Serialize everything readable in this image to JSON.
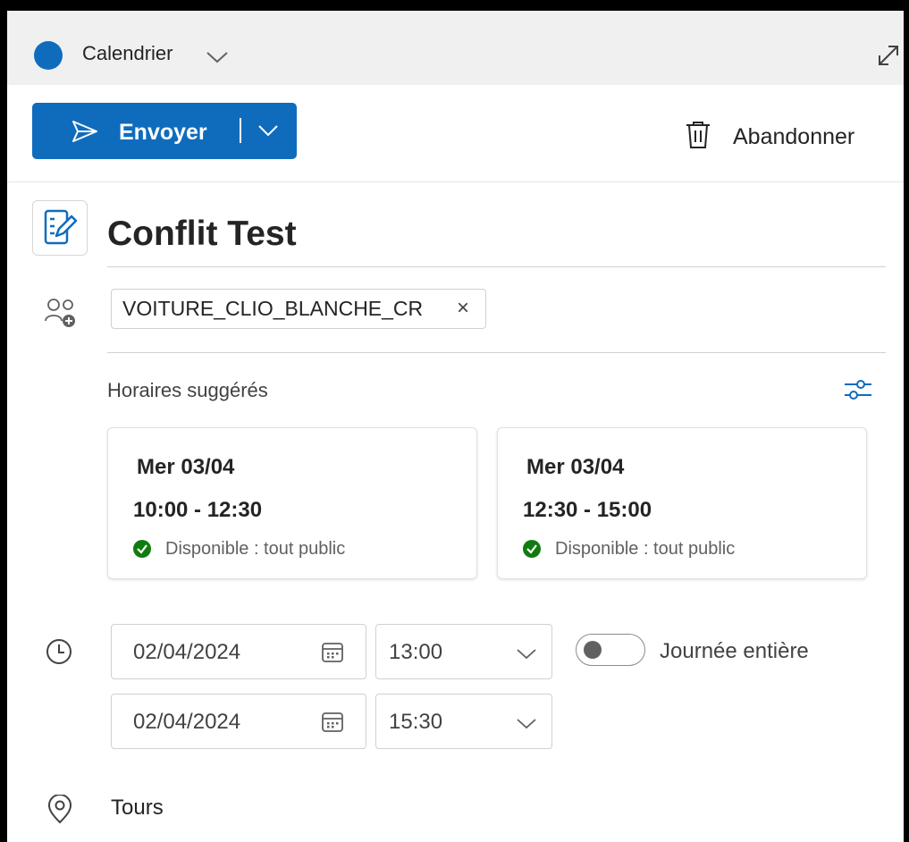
{
  "header": {
    "calendar_label": "Calendrier"
  },
  "toolbar": {
    "send_label": "Envoyer",
    "discard_label": "Abandonner"
  },
  "event": {
    "title": "Conflit Test",
    "attendee_chip": "VOITURE_CLIO_BLANCHE_CR",
    "attendee_remove_glyph": "×"
  },
  "suggestions": {
    "heading": "Horaires suggérés",
    "cards": [
      {
        "day": "Mer 03/04",
        "time": "10:00 - 12:30",
        "status": "Disponible : tout public"
      },
      {
        "day": "Mer 03/04",
        "time": "12:30 - 15:00",
        "status": "Disponible : tout public"
      }
    ]
  },
  "schedule": {
    "start_date": "02/04/2024",
    "start_time": "13:00",
    "end_date": "02/04/2024",
    "end_time": "15:30",
    "all_day_label": "Journée entière",
    "all_day_on": false
  },
  "location": {
    "value": "Tours"
  },
  "colors": {
    "accent": "#0f6cbd",
    "available": "#107c10",
    "topbar": "#f0f0f0"
  },
  "icons": [
    "calendar-color-dot",
    "chevron-down-icon",
    "expand-icon",
    "send-icon",
    "trash-icon",
    "edit-form-icon",
    "add-people-icon",
    "filter-settings-icon",
    "check-circle-icon",
    "calendar-icon",
    "clock-icon",
    "location-icon"
  ]
}
